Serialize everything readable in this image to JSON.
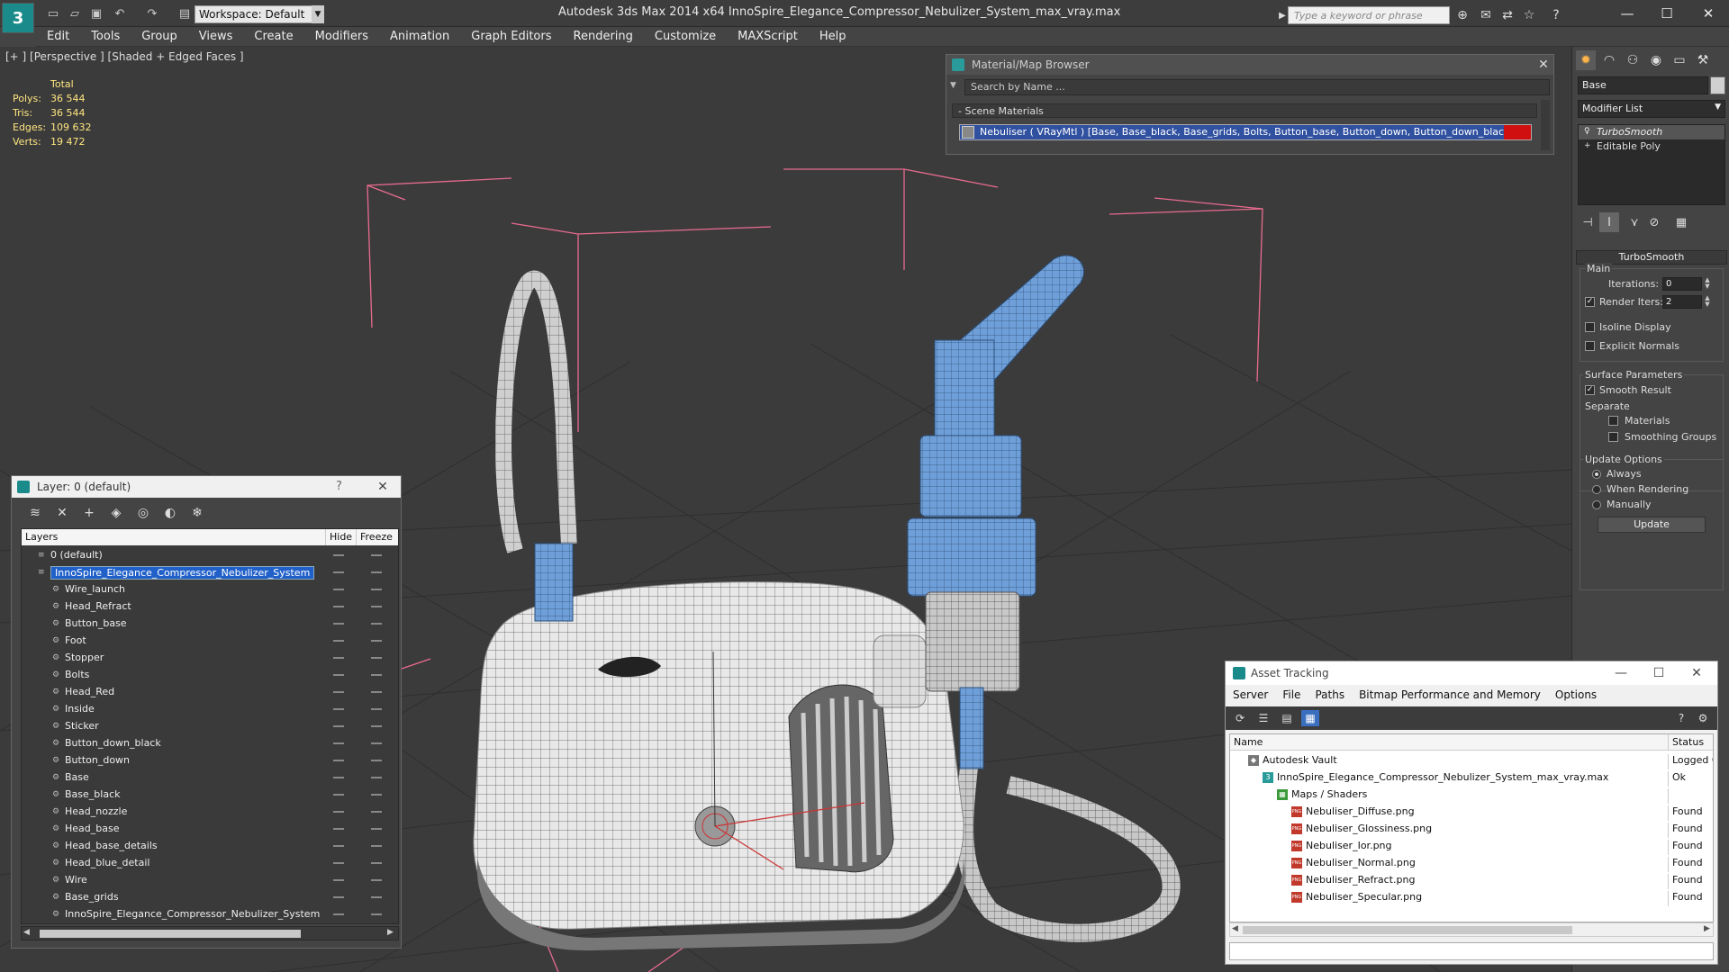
{
  "titlebar": {
    "app_title": "Autodesk 3ds Max  2014 x64      InnoSpire_Elegance_Compressor_Nebulizer_System_max_vray.max",
    "workspace_label": "Workspace: Default",
    "search_placeholder": "Type a keyword or phrase",
    "logo": "3"
  },
  "menubar": {
    "items": [
      "Edit",
      "Tools",
      "Group",
      "Views",
      "Create",
      "Modifiers",
      "Animation",
      "Graph Editors",
      "Rendering",
      "Customize",
      "MAXScript",
      "Help"
    ]
  },
  "viewport": {
    "label": "[+ ] [Perspective ] [Shaded + Edged Faces ]",
    "stats": {
      "header": "Total",
      "rows": [
        {
          "key": "Polys:",
          "value": "36 544"
        },
        {
          "key": "Tris:",
          "value": "36 544"
        },
        {
          "key": "Edges:",
          "value": "109 632"
        },
        {
          "key": "Verts:",
          "value": "19 472"
        }
      ]
    }
  },
  "material_browser": {
    "title": "Material/Map Browser",
    "search_placeholder": "Search by Name ...",
    "section": "- Scene Materials",
    "material_row": "Nebuliser  ( VRayMtl ) [Base, Base_black, Base_grids, Bolts, Button_base, Button_down, Button_down_black, Foot, He..."
  },
  "layer_manager": {
    "title": "Layer: 0 (default)",
    "help": "?",
    "columns": {
      "layers": "Layers",
      "hide": "Hide",
      "freeze": "Freeze"
    },
    "rows": [
      {
        "name": "0 (default)",
        "level": 0
      },
      {
        "name": "InnoSpire_Elegance_Compressor_Nebulizer_System",
        "level": 0,
        "selected": true
      },
      {
        "name": "Wire_launch",
        "level": 1
      },
      {
        "name": "Head_Refract",
        "level": 1
      },
      {
        "name": "Button_base",
        "level": 1
      },
      {
        "name": "Foot",
        "level": 1
      },
      {
        "name": "Stopper",
        "level": 1
      },
      {
        "name": "Bolts",
        "level": 1
      },
      {
        "name": "Head_Red",
        "level": 1
      },
      {
        "name": "Inside",
        "level": 1
      },
      {
        "name": "Sticker",
        "level": 1
      },
      {
        "name": "Button_down_black",
        "level": 1
      },
      {
        "name": "Button_down",
        "level": 1
      },
      {
        "name": "Base",
        "level": 1
      },
      {
        "name": "Base_black",
        "level": 1
      },
      {
        "name": "Head_nozzle",
        "level": 1
      },
      {
        "name": "Head_base",
        "level": 1
      },
      {
        "name": "Head_base_details",
        "level": 1
      },
      {
        "name": "Head_blue_detail",
        "level": 1
      },
      {
        "name": "Wire",
        "level": 1
      },
      {
        "name": "Base_grids",
        "level": 1
      },
      {
        "name": "InnoSpire_Elegance_Compressor_Nebulizer_System",
        "level": 1
      }
    ]
  },
  "command_panel": {
    "object_name": "Base",
    "modifier_list": "Modifier List",
    "stack": [
      "TurboSmooth",
      "Editable Poly"
    ],
    "turbosmooth": {
      "title": "TurboSmooth",
      "main": "Main",
      "iterations_label": "Iterations:",
      "iterations_value": "0",
      "render_iters_label": "Render Iters:",
      "render_iters_value": "2",
      "isoline": "Isoline Display",
      "explicit_normals": "Explicit Normals",
      "surface_params": "Surface Parameters",
      "smooth_result": "Smooth Result",
      "separate": "Separate",
      "materials": "Materials",
      "smoothing_groups": "Smoothing Groups",
      "update_options": "Update Options",
      "always": "Always",
      "when_rendering": "When Rendering",
      "manually": "Manually",
      "update_button": "Update"
    }
  },
  "asset_tracking": {
    "title": "Asset Tracking",
    "menu": [
      "Server",
      "File",
      "Paths",
      "Bitmap Performance and Memory",
      "Options"
    ],
    "columns": {
      "name": "Name",
      "status": "Status"
    },
    "rows": [
      {
        "name": "Autodesk Vault",
        "status": "Logged Out",
        "level": 0,
        "icon": "vault"
      },
      {
        "name": "InnoSpire_Elegance_Compressor_Nebulizer_System_max_vray.max",
        "status": "Ok",
        "level": 1,
        "icon": "max"
      },
      {
        "name": "Maps / Shaders",
        "status": "",
        "level": 2,
        "icon": "maps"
      },
      {
        "name": "Nebuliser_Diffuse.png",
        "status": "Found",
        "level": 3,
        "icon": "png"
      },
      {
        "name": "Nebuliser_Glossiness.png",
        "status": "Found",
        "level": 3,
        "icon": "png"
      },
      {
        "name": "Nebuliser_Ior.png",
        "status": "Found",
        "level": 3,
        "icon": "png"
      },
      {
        "name": "Nebuliser_Normal.png",
        "status": "Found",
        "level": 3,
        "icon": "png"
      },
      {
        "name": "Nebuliser_Refract.png",
        "status": "Found",
        "level": 3,
        "icon": "png"
      },
      {
        "name": "Nebuliser_Specular.png",
        "status": "Found",
        "level": 3,
        "icon": "png"
      }
    ]
  },
  "colors": {
    "selection_blue": "#2060c8",
    "stats_yellow": "#ffe680",
    "material_red": "#d01010",
    "bbox_pink": "#e86b8f",
    "model_blue": "#6f9fd8"
  }
}
